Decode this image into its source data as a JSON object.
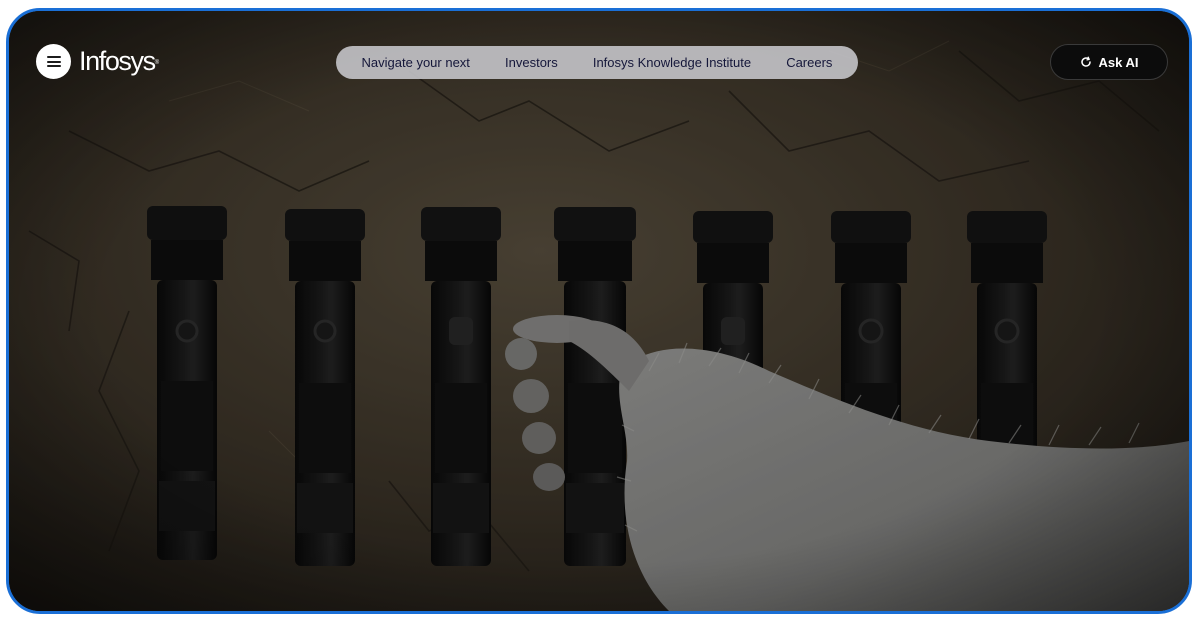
{
  "header": {
    "brand": "Infosys",
    "brand_mark": "®",
    "nav": [
      {
        "label": "Navigate your next"
      },
      {
        "label": "Investors"
      },
      {
        "label": "Infosys Knowledge Institute"
      },
      {
        "label": "Careers"
      }
    ],
    "ask_ai_label": "Ask AI"
  },
  "hero": {
    "subject": "flashlights-on-rock-with-furry-paw",
    "flashlight_count": 7
  },
  "colors": {
    "frame_border": "#1a6fd6",
    "nav_pill_bg": "#c8c8cd",
    "nav_text": "#15173a",
    "ask_ai_bg": "#0c0c0c"
  },
  "icons": {
    "menu": "hamburger-icon",
    "ask_ai": "refresh-sparkle-icon"
  }
}
